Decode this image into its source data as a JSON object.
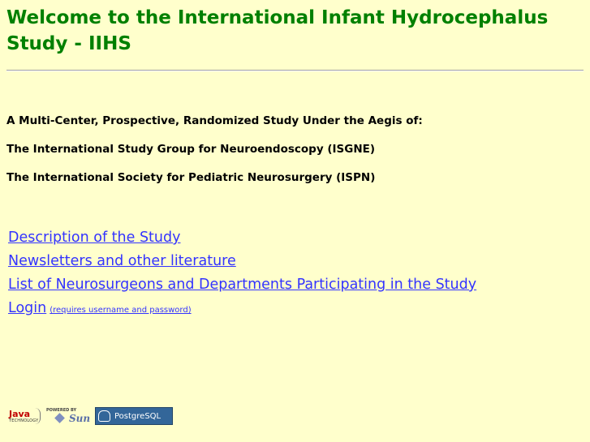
{
  "header": {
    "title": "Welcome to the International Infant Hydrocephalus Study - IIHS"
  },
  "intro": {
    "text": "A Multi-Center, Prospective, Randomized Study Under the Aegis of:",
    "org1": "The International Study Group for Neuroendoscopy (ISGNE)",
    "org2": "The International Society for Pediatric Neurosurgery (ISPN)"
  },
  "links": {
    "description": "Description of the Study",
    "newsletters": "Newsletters and other literature",
    "neurosurgeons": "List of Neurosurgeons and Departments Participating in the Study",
    "login": "Login",
    "login_note": "(requires username and password)"
  },
  "badges": {
    "java": "Java",
    "java_sub": "TECHNOLOGY",
    "sun_powered": "POWERED BY",
    "sun": "Sun",
    "postgres": "PostgreSQL"
  },
  "colors": {
    "background": "#ffffcc",
    "title": "#008000",
    "link": "#3333ff"
  }
}
